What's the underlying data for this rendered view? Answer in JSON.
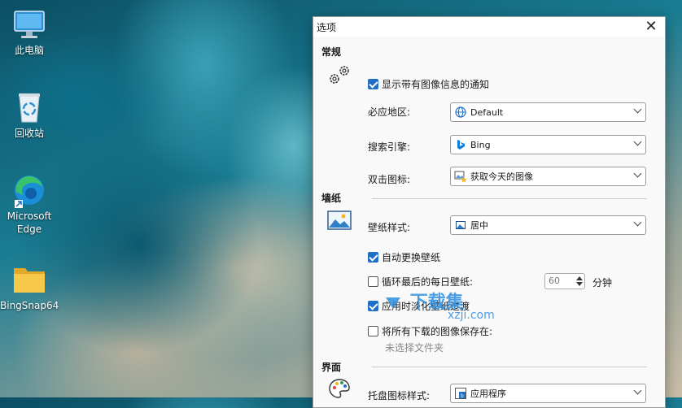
{
  "desktop": {
    "icons": [
      {
        "label": "此电脑",
        "icon": "monitor-icon"
      },
      {
        "label": "回收站",
        "icon": "recycle-bin-icon"
      },
      {
        "label": "Microsoft Edge",
        "icon": "edge-icon"
      },
      {
        "label": "BingSnap64",
        "icon": "folder-icon"
      }
    ]
  },
  "window": {
    "title": "选项",
    "close": "✕"
  },
  "general": {
    "title": "常规",
    "notify_label": "显示带有图像信息的通知",
    "notify_checked": true,
    "region_label": "必应地区:",
    "region_value": "Default",
    "search_label": "搜索引擎:",
    "search_value": "Bing",
    "dblclick_label": "双击图标:",
    "dblclick_value": "获取今天的图像"
  },
  "wallpaper": {
    "title": "墙纸",
    "style_label": "壁纸样式:",
    "style_value": "居中",
    "auto_change_label": "自动更换壁纸",
    "auto_change_checked": true,
    "cycle_label": "循环最后的每日壁纸:",
    "cycle_checked": false,
    "cycle_value": "60",
    "cycle_unit": "分钟",
    "fade_label": "应用时淡化壁纸过渡",
    "fade_checked": true,
    "save_label": "将所有下载的图像保存在:",
    "save_checked": false,
    "folder_placeholder": "未选择文件夹"
  },
  "interface": {
    "title": "界面",
    "tray_label": "托盘图标样式:",
    "tray_value": "应用程序"
  },
  "watermark": {
    "main": "下载集",
    "sub": "xzji.com"
  },
  "colors": {
    "accent": "#1f6fc6",
    "bing_blue": "#0f7dd8"
  }
}
